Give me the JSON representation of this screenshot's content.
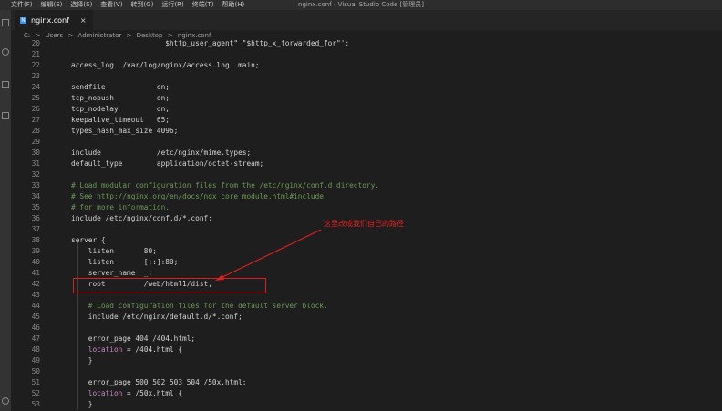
{
  "window": {
    "title": "nginx.conf - Visual Studio Code [管理员]",
    "menu": [
      "文件(F)",
      "编辑(E)",
      "选择(S)",
      "查看(V)",
      "转到(G)",
      "运行(R)",
      "终端(T)",
      "帮助(H)"
    ]
  },
  "tab": {
    "label": "nginx.conf",
    "close": "×"
  },
  "breadcrumb": [
    "C:",
    ">",
    "Users",
    ">",
    "Administrator",
    ">",
    "Desktop",
    ">",
    "nginx.conf"
  ],
  "editor": {
    "lines": [
      {
        "n": "20",
        "text": "                      $http_user_agent\" \"$http_x_forwarded_for\"';",
        "type": "code"
      },
      {
        "n": "21",
        "text": "",
        "type": "code"
      },
      {
        "n": "22",
        "text": "access_log  /var/log/nginx/access.log  main;",
        "type": "code"
      },
      {
        "n": "23",
        "text": "",
        "type": "code"
      },
      {
        "n": "24",
        "text": "sendfile            on;",
        "type": "code"
      },
      {
        "n": "25",
        "text": "tcp_nopush          on;",
        "type": "code"
      },
      {
        "n": "26",
        "text": "tcp_nodelay         on;",
        "type": "code"
      },
      {
        "n": "27",
        "text": "keepalive_timeout   65;",
        "type": "code"
      },
      {
        "n": "28",
        "text": "types_hash_max_size 4096;",
        "type": "code"
      },
      {
        "n": "29",
        "text": "",
        "type": "code"
      },
      {
        "n": "30",
        "text": "include             /etc/nginx/mime.types;",
        "type": "code"
      },
      {
        "n": "31",
        "text": "default_type        application/octet-stream;",
        "type": "code"
      },
      {
        "n": "32",
        "text": "",
        "type": "code"
      },
      {
        "n": "33",
        "text": "# Load modular configuration files from the /etc/nginx/conf.d directory.",
        "type": "comment"
      },
      {
        "n": "34",
        "text": "# See http://nginx.org/en/docs/ngx_core_module.html#include",
        "type": "comment"
      },
      {
        "n": "35",
        "text": "# for more information.",
        "type": "comment"
      },
      {
        "n": "36",
        "text": "include /etc/nginx/conf.d/*.conf;",
        "type": "code"
      },
      {
        "n": "37",
        "text": "",
        "type": "code"
      },
      {
        "n": "38",
        "text": "server {",
        "type": "code"
      },
      {
        "n": "39",
        "text": "    listen       80;",
        "type": "code"
      },
      {
        "n": "40",
        "text": "    listen       [::]:80;",
        "type": "code"
      },
      {
        "n": "41",
        "text": "    server_name  _;",
        "type": "code"
      },
      {
        "n": "42",
        "text": "    root         /web/html1/dist;",
        "type": "code"
      },
      {
        "n": "43",
        "text": "",
        "type": "code"
      },
      {
        "n": "44",
        "text": "    # Load configuration files for the default server block.",
        "type": "comment"
      },
      {
        "n": "45",
        "text": "    include /etc/nginx/default.d/*.conf;",
        "type": "code"
      },
      {
        "n": "46",
        "text": "",
        "type": "code"
      },
      {
        "n": "47",
        "text": "    error_page 404 /404.html;",
        "type": "code"
      },
      {
        "n": "48",
        "text": "    location = /404.html {",
        "type": "location"
      },
      {
        "n": "49",
        "text": "    }",
        "type": "code"
      },
      {
        "n": "50",
        "text": "",
        "type": "code"
      },
      {
        "n": "51",
        "text": "    error_page 500 502 503 504 /50x.html;",
        "type": "code"
      },
      {
        "n": "52",
        "text": "    location = /50x.html {",
        "type": "location"
      },
      {
        "n": "53",
        "text": "    }",
        "type": "code"
      }
    ]
  },
  "annotation": {
    "text": "这里改成我们自己的路径",
    "color": "#e02020"
  },
  "colors": {
    "comment": "#6a9955",
    "keyword": "#c586c0",
    "annotation": "#e02020"
  }
}
